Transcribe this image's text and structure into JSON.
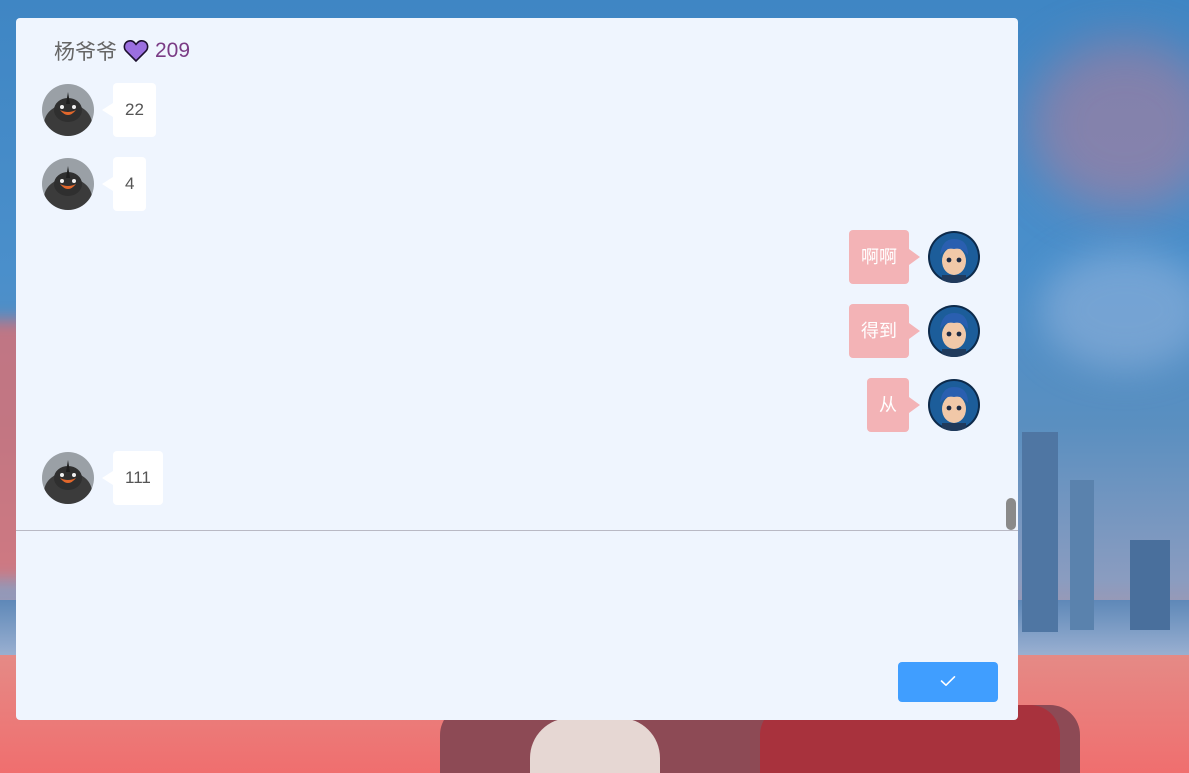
{
  "chat": {
    "contact_name": "杨爷爷",
    "heart_icon": "heart-icon",
    "heart_color": "#9b6fe0",
    "like_count": "209"
  },
  "messages": [
    {
      "side": "left",
      "text": "22",
      "avatar": "bird-avatar"
    },
    {
      "side": "left",
      "text": "4",
      "avatar": "bird-avatar"
    },
    {
      "side": "right",
      "text": "啊啊",
      "avatar": "boy-avatar"
    },
    {
      "side": "right",
      "text": "得到",
      "avatar": "boy-avatar"
    },
    {
      "side": "right",
      "text": "从",
      "avatar": "boy-avatar"
    },
    {
      "side": "left",
      "text": "111",
      "avatar": "bird-avatar"
    }
  ],
  "composer": {
    "value": "",
    "send_icon": "check-icon",
    "send_button_color": "#409eff"
  },
  "colors": {
    "panel_background": "#eff5fe",
    "sent_bubble": "#f3b3b6",
    "received_bubble": "#ffffff"
  }
}
